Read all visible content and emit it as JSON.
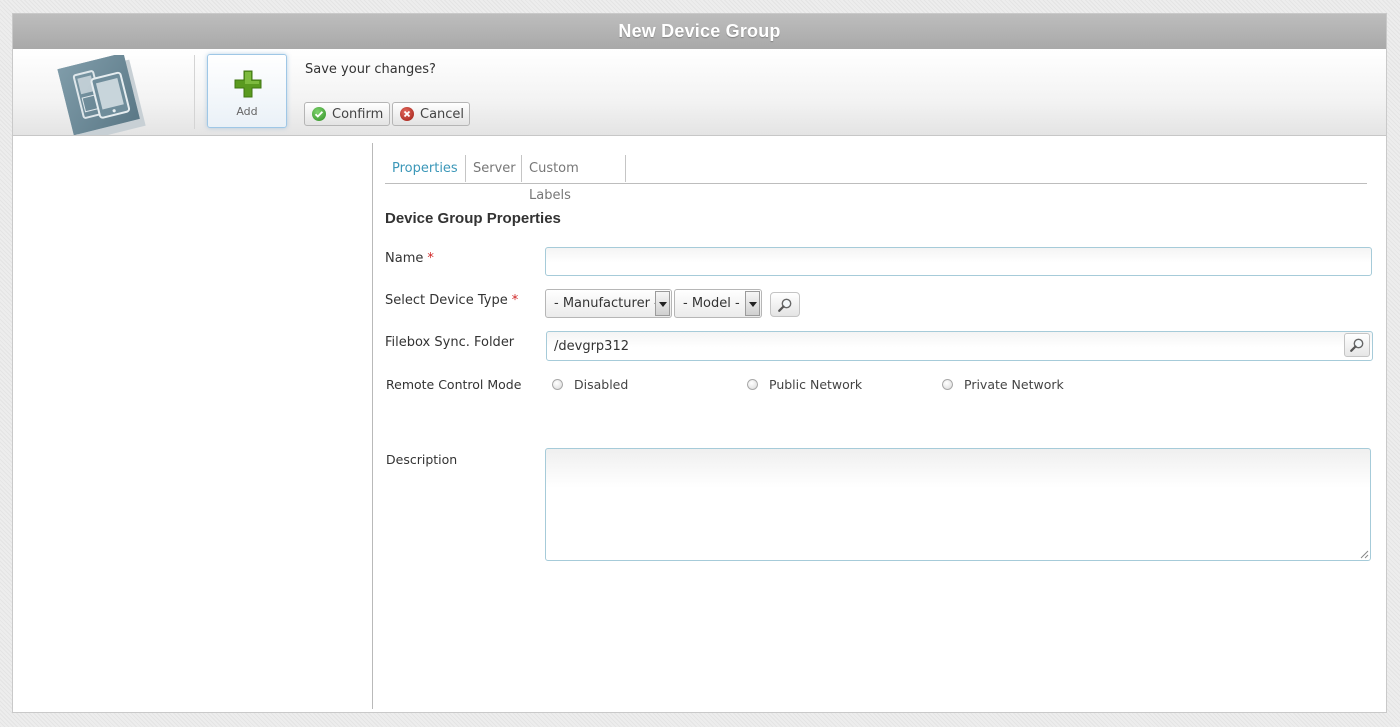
{
  "window": {
    "title": "New Device Group"
  },
  "toolbar": {
    "add_label": "Add",
    "prompt": "Save your changes?",
    "confirm_label": "Confirm",
    "cancel_label": "Cancel"
  },
  "tabs": [
    {
      "label": "Properties",
      "active": true
    },
    {
      "label": "Server",
      "active": false
    },
    {
      "label": "Custom Labels",
      "active": false
    }
  ],
  "form": {
    "section_title": "Device Group Properties",
    "required_marker": "*",
    "name": {
      "label": "Name",
      "required": true,
      "value": ""
    },
    "device_type": {
      "label": "Select Device Type",
      "required": true,
      "manufacturer_selected": "- Manufacturer -",
      "model_selected": "- Model -"
    },
    "filebox": {
      "label": "Filebox Sync. Folder",
      "value": "/devgrp312"
    },
    "remote_control": {
      "label": "Remote Control Mode",
      "options": [
        "Disabled",
        "Public Network",
        "Private Network"
      ],
      "selected": null
    },
    "description": {
      "label": "Description",
      "value": ""
    }
  },
  "colors": {
    "title_bar": "#b0b0b0",
    "active_tab": "#3b97b8",
    "required": "#d02525",
    "input_border": "#a6cbd9",
    "add_icon": "#5a9a1f"
  },
  "icons": {
    "app_logo": "device-group-icon",
    "add": "plus-icon",
    "confirm": "check-circle-icon",
    "cancel": "x-circle-icon",
    "search": "magnifier-icon"
  }
}
